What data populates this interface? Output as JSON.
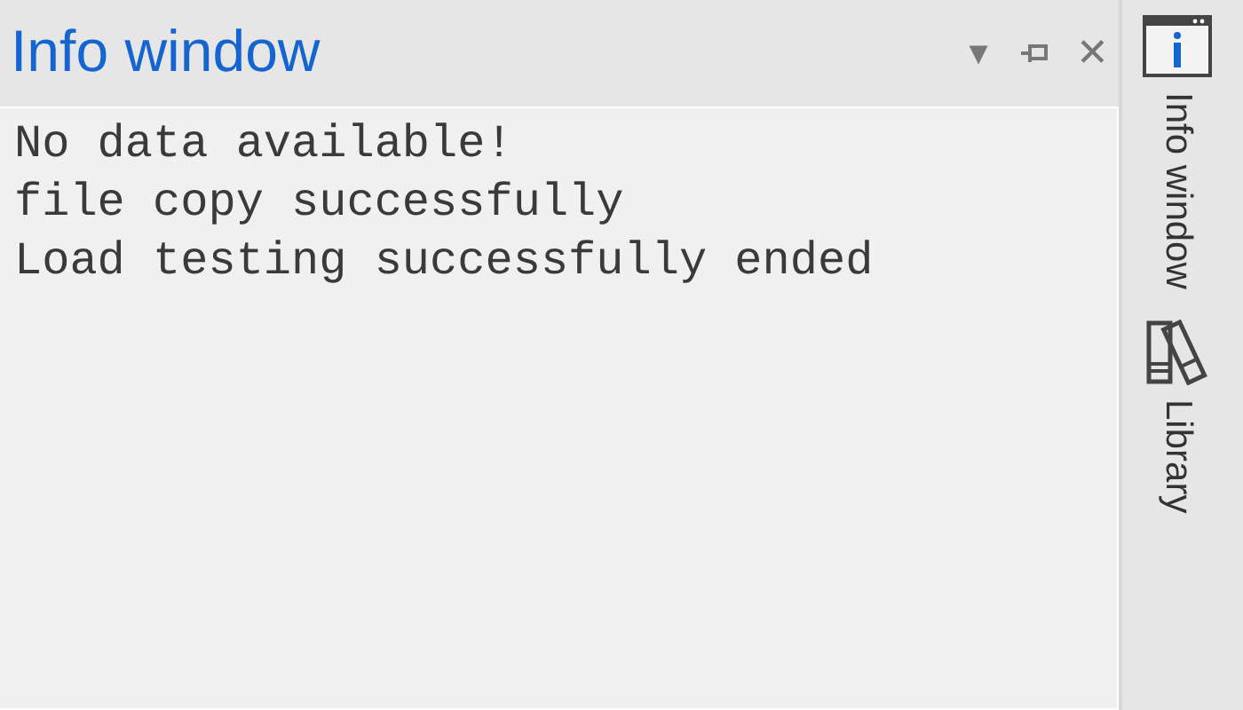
{
  "panel": {
    "title": "Info window",
    "menu_glyph": "▼",
    "close_glyph": "✕"
  },
  "messages": [
    "No data available!",
    "file copy successfully",
    "Load testing successfully ended"
  ],
  "side_tabs": [
    {
      "label": "Info window",
      "kind": "info"
    },
    {
      "label": "Library",
      "kind": "library"
    }
  ]
}
